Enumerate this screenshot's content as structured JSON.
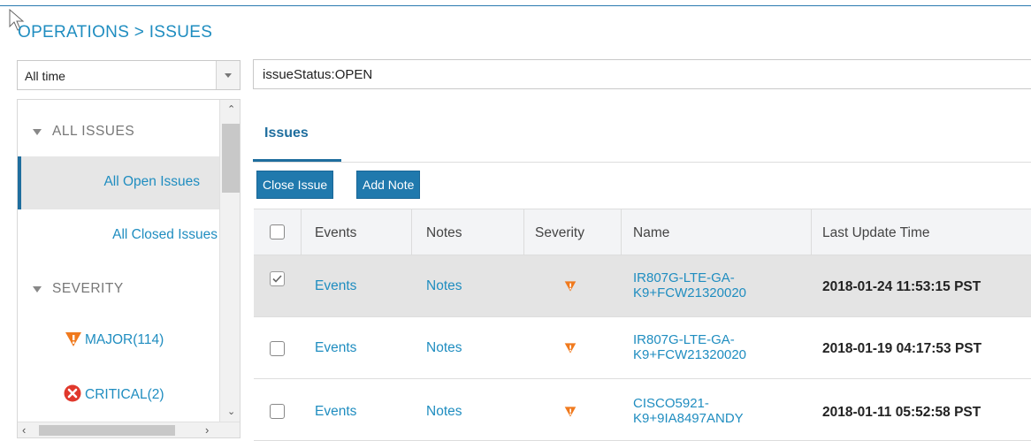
{
  "breadcrumb": "OPERATIONS > ISSUES",
  "filter": {
    "time_value": "All time",
    "query_value": "issueStatus:OPEN"
  },
  "sidebar": {
    "all_issues_heading": "ALL ISSUES",
    "all_open": "All Open Issues",
    "all_closed": "All Closed Issues",
    "severity_heading": "SEVERITY",
    "major": "MAJOR(114)",
    "critical": "CRITICAL(2)"
  },
  "tab_label": "Issues",
  "buttons": {
    "close_issue": "Close Issue",
    "add_note": "Add Note"
  },
  "table": {
    "headers": {
      "events": "Events",
      "notes": "Notes",
      "severity": "Severity",
      "name": "Name",
      "last_update": "Last Update Time"
    },
    "rows": [
      {
        "selected": true,
        "events": "Events",
        "notes": "Notes",
        "severity": "major",
        "name_line1": "IR807G-LTE-GA-",
        "name_line2": "K9+FCW21320020",
        "time": "2018-01-24 11:53:15 PST"
      },
      {
        "selected": false,
        "events": "Events",
        "notes": "Notes",
        "severity": "major",
        "name_line1": "IR807G-LTE-GA-",
        "name_line2": "K9+FCW21320020",
        "time": "2018-01-19 04:17:53 PST"
      },
      {
        "selected": false,
        "events": "Events",
        "notes": "Notes",
        "severity": "major",
        "name_line1": "CISCO5921-",
        "name_line2": "K9+9IA8497ANDY",
        "time": "2018-01-11 05:52:58 PST"
      }
    ]
  },
  "colors": {
    "accent": "#1f8dc0",
    "button": "#2079ad",
    "major": "#f07a1e",
    "critical": "#e0382c"
  },
  "icons": {
    "major": "major-severity-icon",
    "critical": "critical-severity-icon"
  }
}
